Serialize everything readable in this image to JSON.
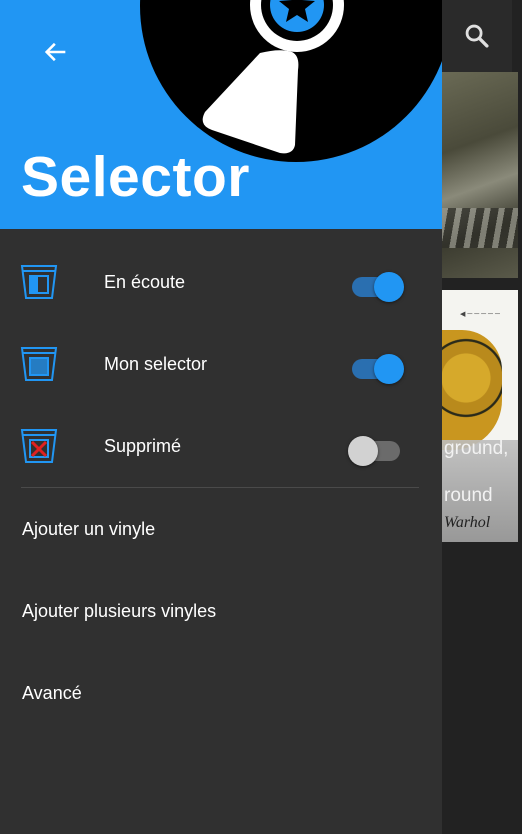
{
  "background": {
    "album_1_title_fragment": "ground,",
    "album_1_subtitle_fragment": "round",
    "album_2_signature_fragment": "Warhol"
  },
  "drawer": {
    "title": "Selector",
    "accent_color": "#2196f3",
    "background_color": "#303030",
    "toggles": [
      {
        "label": "En écoute",
        "icon": "listening-box-icon",
        "on": true
      },
      {
        "label": "Mon selector",
        "icon": "selector-box-icon",
        "on": true
      },
      {
        "label": "Supprimé",
        "icon": "deleted-box-icon",
        "on": false
      }
    ],
    "menu": [
      {
        "label": "Ajouter un vinyle"
      },
      {
        "label": "Ajouter plusieurs vinyles"
      },
      {
        "label": "Avancé"
      }
    ]
  }
}
